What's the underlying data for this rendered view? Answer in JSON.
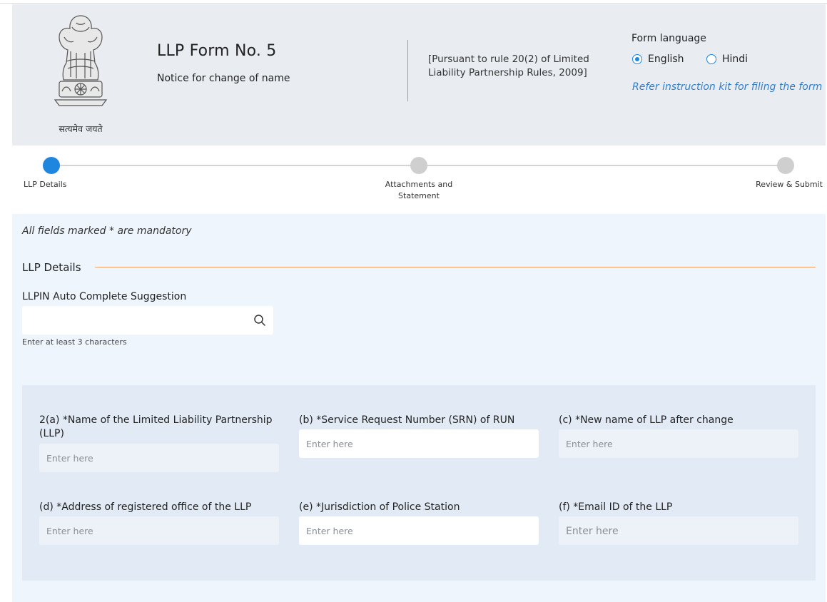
{
  "header": {
    "emblem_motto": "सत्यमेव जयते",
    "form_title": "LLP Form No. 5",
    "form_subtitle": "Notice for change of name",
    "rule_reference": "[Pursuant to rule 20(2) of Limited Liability Partnership Rules, 2009]",
    "language_label": "Form language",
    "language_options": [
      {
        "label": "English",
        "selected": true
      },
      {
        "label": "Hindi",
        "selected": false
      }
    ],
    "instruction_link": "Refer instruction kit for filing the form"
  },
  "stepper": {
    "steps": [
      {
        "label": "LLP Details",
        "active": true
      },
      {
        "label": "Attachments and Statement",
        "active": false
      },
      {
        "label": "Review & Submit",
        "active": false
      }
    ]
  },
  "main": {
    "mandatory_note": "All fields marked * are mandatory",
    "section_title": "LLP Details",
    "llpin_label": "LLPIN Auto Complete Suggestion",
    "llpin_value": "",
    "llpin_hint": "Enter at least 3 characters",
    "fields": [
      {
        "label": "2(a) *Name of the Limited Liability Partnership (LLP)",
        "placeholder": "Enter here",
        "value": ""
      },
      {
        "label": "(b) *Service Request Number (SRN) of RUN",
        "placeholder": "Enter here",
        "value": ""
      },
      {
        "label": "(c) *New name of LLP after change",
        "placeholder": "Enter here",
        "value": ""
      },
      {
        "label": "(d) *Address of registered office of the LLP",
        "placeholder": "Enter here",
        "value": ""
      },
      {
        "label": "(e) *Jurisdiction of Police Station",
        "placeholder": "Enter here",
        "value": ""
      },
      {
        "label": "(f) *Email ID of the LLP",
        "placeholder": "Enter here",
        "value": ""
      }
    ]
  },
  "colors": {
    "accent_blue": "#1f86e0",
    "link_blue": "#2f7fd0",
    "section_rule_orange": "#f0a46a",
    "header_bg": "#e9edf1",
    "main_bg": "#eef5fd"
  }
}
